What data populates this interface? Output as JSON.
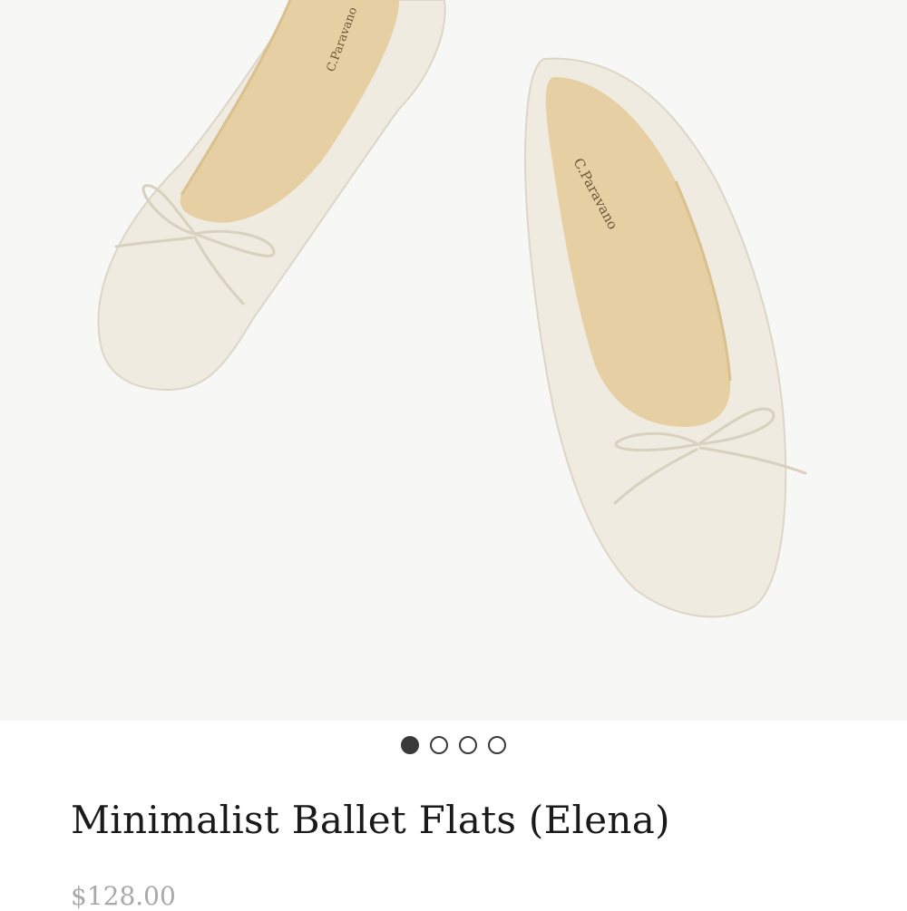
{
  "product": {
    "title": "Minimalist Ballet Flats (Elena)",
    "price": "$128.00",
    "brand_imprint": "C.Paravano"
  },
  "gallery": {
    "image_count": 4,
    "active_index": 0,
    "image_alt": "Pair of cream ballet flats with bow"
  },
  "colors": {
    "background": "#f7f7f6",
    "shoe_leather": "#efebe1",
    "insole": "#e6cfa2",
    "dot_active": "#3a3a3a"
  }
}
